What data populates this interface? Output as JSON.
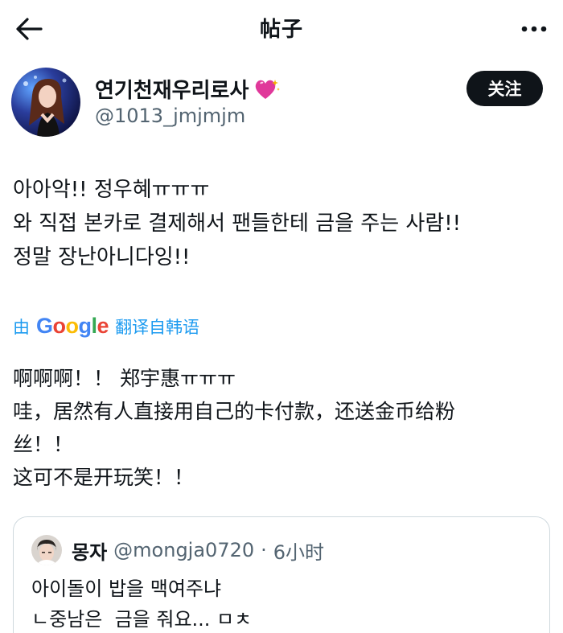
{
  "header": {
    "title": "帖子"
  },
  "author": {
    "name": "연기천재우리로사",
    "handle": "@1013_jmjmjm",
    "emoji_icon": "sparkling-heart-icon"
  },
  "follow_label": "关注",
  "post": {
    "lines": [
      "아아악!! 정우혜ㅠㅠㅠ",
      "와 직접 본카로 결제해서 팬들한테 금을 주는 사람!!",
      "정말 장난아니다잉!!"
    ]
  },
  "translation": {
    "prefix": "由",
    "brand": "Google",
    "suffix": "翻译自韩语",
    "lines": [
      "啊啊啊！！ 郑宇惠ㅠㅠㅠ",
      "哇，居然有人直接用自己的卡付款，还送金币给粉",
      "丝！！",
      "这可不是开玩笑！！"
    ]
  },
  "quote": {
    "name": "몽자",
    "handle": "@mongja0720",
    "separator": "·",
    "time": "6小时",
    "lines": [
      "아이돌이 밥을 맥여주냐",
      "ㄴ중남은  금을 줘요... ㅁㅊ"
    ]
  },
  "colors": {
    "text": "#0f1419",
    "secondary": "#536471",
    "link": "#1d9bf0",
    "follow_bg": "#0f1419",
    "border": "#cfd9de",
    "heart": "#e0389a"
  }
}
